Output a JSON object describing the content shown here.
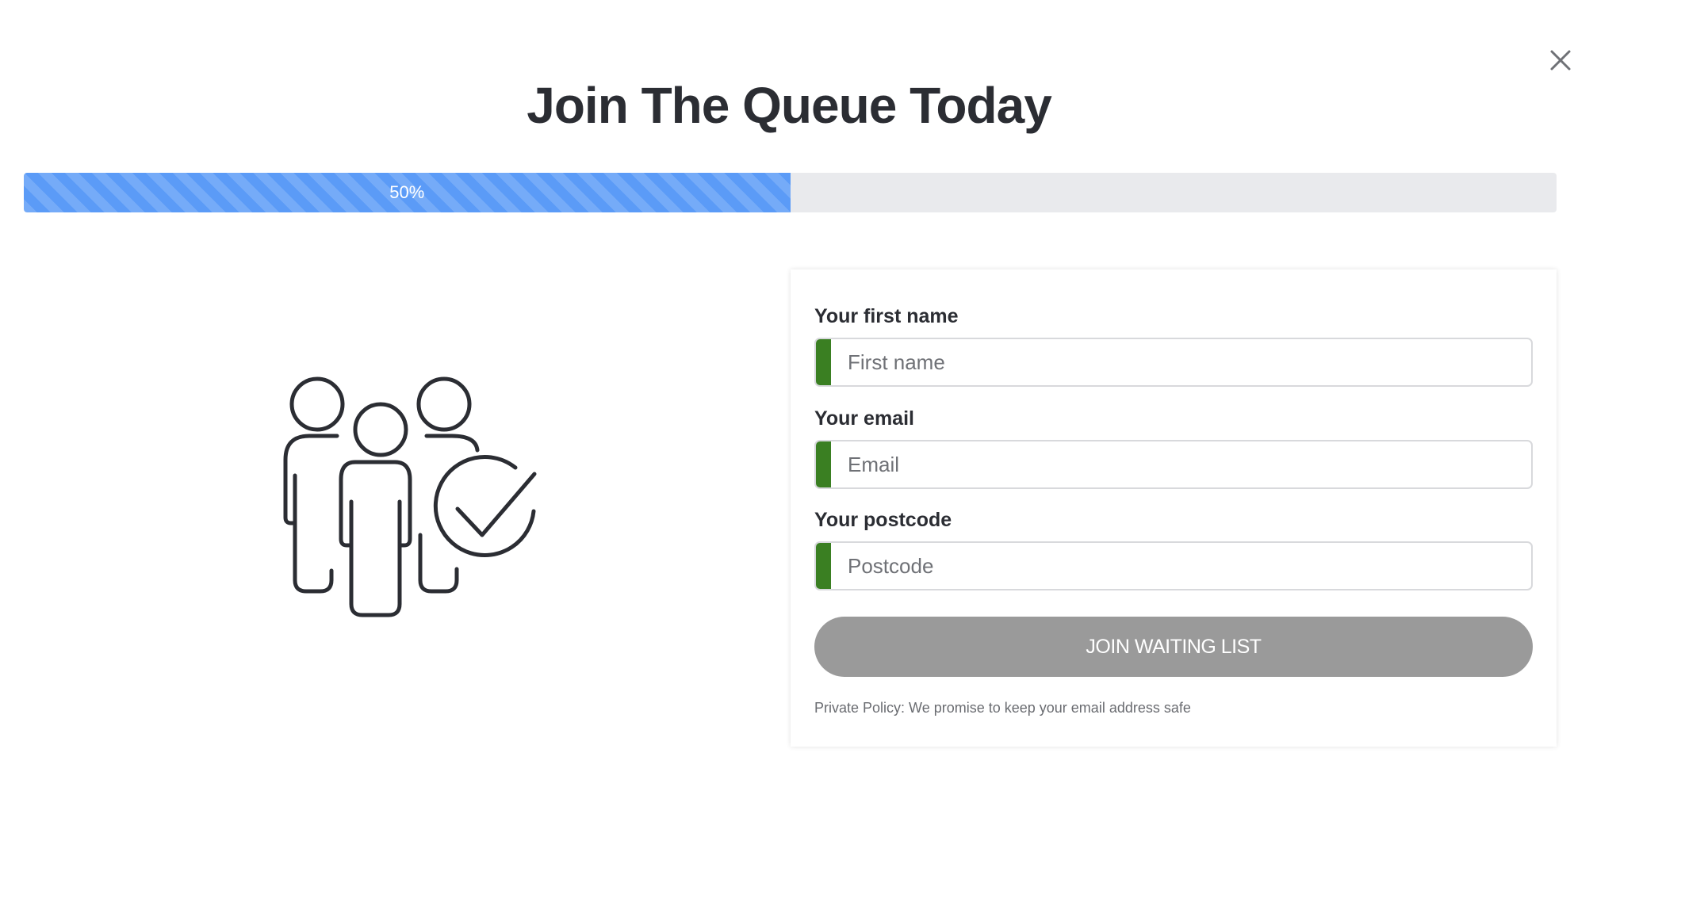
{
  "modal": {
    "close_icon": "close-icon",
    "title": "Join The Queue Today"
  },
  "progress": {
    "percent": 50,
    "label": "50%",
    "fill_color": "#5b9bf7",
    "track_color": "#e9eaed"
  },
  "illustration": {
    "icon": "group-users-check-icon"
  },
  "form": {
    "accent_color": "#3a7f22",
    "fields": [
      {
        "label": "Your first name",
        "placeholder": "First name",
        "value": ""
      },
      {
        "label": "Your email",
        "placeholder": "Email",
        "value": ""
      },
      {
        "label": "Your postcode",
        "placeholder": "Postcode",
        "value": ""
      }
    ],
    "submit_label": "JOIN WAITING LIST",
    "submit_color": "#9a9a9a",
    "policy_text": "Private Policy: We promise to keep your email address safe"
  }
}
